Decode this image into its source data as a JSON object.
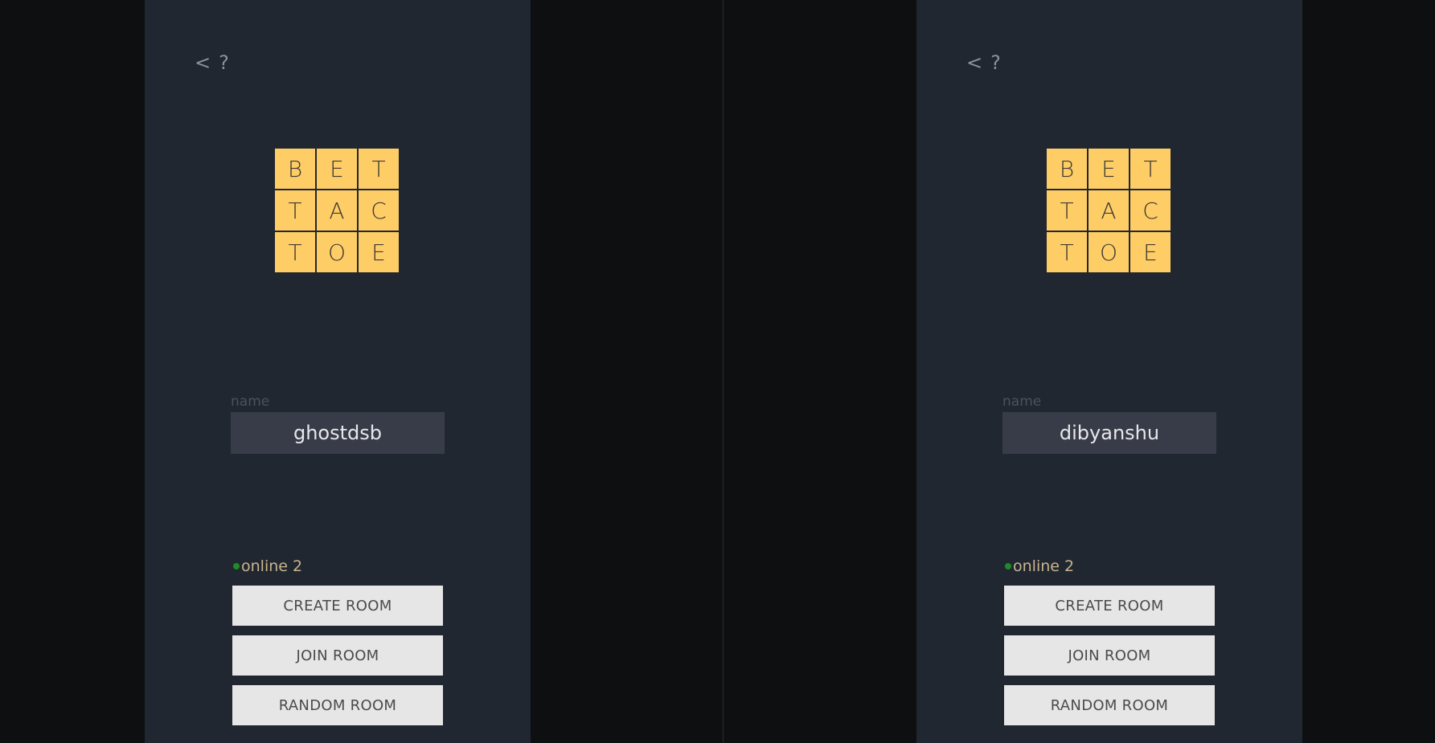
{
  "panels": [
    {
      "nav": {
        "back": "<",
        "help": "?"
      },
      "logo": [
        "B",
        "E",
        "T",
        "T",
        "A",
        "C",
        "T",
        "O",
        "E"
      ],
      "name_label": "name",
      "name_value": "ghostdsb",
      "online_text": "online 2",
      "buttons": {
        "create": "CREATE ROOM",
        "join": "JOIN ROOM",
        "random": "RANDOM ROOM"
      }
    },
    {
      "nav": {
        "back": "<",
        "help": "?"
      },
      "logo": [
        "B",
        "E",
        "T",
        "T",
        "A",
        "C",
        "T",
        "O",
        "E"
      ],
      "name_label": "name",
      "name_value": "dibyanshu",
      "online_text": "online 2",
      "buttons": {
        "create": "CREATE ROOM",
        "join": "JOIN ROOM",
        "random": "RANDOM ROOM"
      }
    }
  ],
  "colors": {
    "background": "#0e0f10",
    "panel": "#212731",
    "logo_tile": "#ffcd66",
    "input_bg": "#383c48",
    "online_dot": "#1f8a2a",
    "button_bg": "#e6e6e6"
  }
}
